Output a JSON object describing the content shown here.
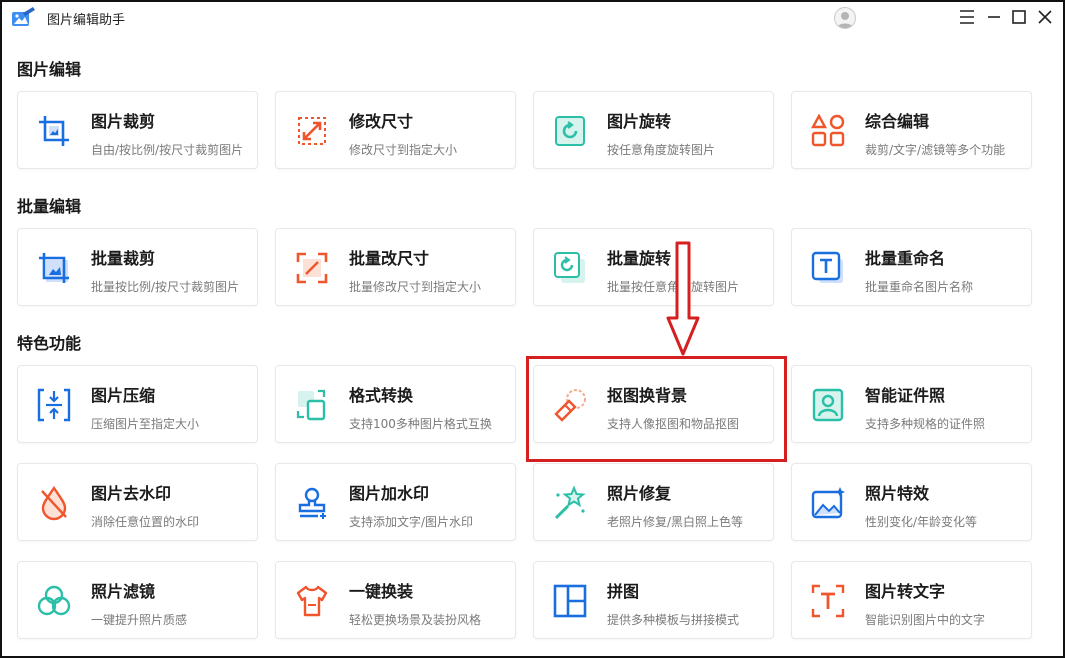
{
  "window": {
    "title": "图片编辑助手",
    "controls": [
      "menu-icon",
      "minimize-icon",
      "maximize-icon",
      "close-icon"
    ]
  },
  "sections": [
    {
      "title": "图片编辑",
      "cards": [
        {
          "title": "图片裁剪",
          "desc": "自由/按比例/按尺寸裁剪图片",
          "icon": "crop-icon"
        },
        {
          "title": "修改尺寸",
          "desc": "修改尺寸到指定大小",
          "icon": "resize-icon"
        },
        {
          "title": "图片旋转",
          "desc": "按任意角度旋转图片",
          "icon": "rotate-icon"
        },
        {
          "title": "综合编辑",
          "desc": "裁剪/文字/滤镜等多个功能",
          "icon": "shapes-icon"
        }
      ]
    },
    {
      "title": "批量编辑",
      "cards": [
        {
          "title": "批量裁剪",
          "desc": "批量按比例/按尺寸裁剪图片",
          "icon": "batch-crop-icon"
        },
        {
          "title": "批量改尺寸",
          "desc": "批量修改尺寸到指定大小",
          "icon": "batch-resize-icon"
        },
        {
          "title": "批量旋转",
          "desc": "批量按任意角度旋转图片",
          "icon": "batch-rotate-icon"
        },
        {
          "title": "批量重命名",
          "desc": "批量重命名图片名称",
          "icon": "rename-icon"
        }
      ]
    },
    {
      "title": "特色功能",
      "cards": [
        {
          "title": "图片压缩",
          "desc": "压缩图片至指定大小",
          "icon": "compress-icon"
        },
        {
          "title": "格式转换",
          "desc": "支持100多种图片格式互换",
          "icon": "format-convert-icon"
        },
        {
          "title": "抠图换背景",
          "desc": "支持人像抠图和物品抠图",
          "icon": "eraser-icon"
        },
        {
          "title": "智能证件照",
          "desc": "支持多种规格的证件照",
          "icon": "id-photo-icon"
        },
        {
          "title": "图片去水印",
          "desc": "消除任意位置的水印",
          "icon": "remove-watermark-icon"
        },
        {
          "title": "图片加水印",
          "desc": "支持添加文字/图片水印",
          "icon": "add-watermark-icon"
        },
        {
          "title": "照片修复",
          "desc": "老照片修复/黑白照上色等",
          "icon": "magic-wand-icon"
        },
        {
          "title": "照片特效",
          "desc": "性别变化/年龄变化等",
          "icon": "photo-effect-icon"
        },
        {
          "title": "照片滤镜",
          "desc": "一键提升照片质感",
          "icon": "filter-icon"
        },
        {
          "title": "一键换装",
          "desc": "轻松更换场景及装扮风格",
          "icon": "shirt-icon"
        },
        {
          "title": "拼图",
          "desc": "提供多种模板与拼接模式",
          "icon": "collage-icon"
        },
        {
          "title": "图片转文字",
          "desc": "智能识别图片中的文字",
          "icon": "ocr-icon"
        }
      ]
    }
  ],
  "colors": {
    "blue": "#1a6fe0",
    "orange": "#f0552c",
    "teal": "#2bbfa8",
    "annotation_red": "#d42020"
  }
}
